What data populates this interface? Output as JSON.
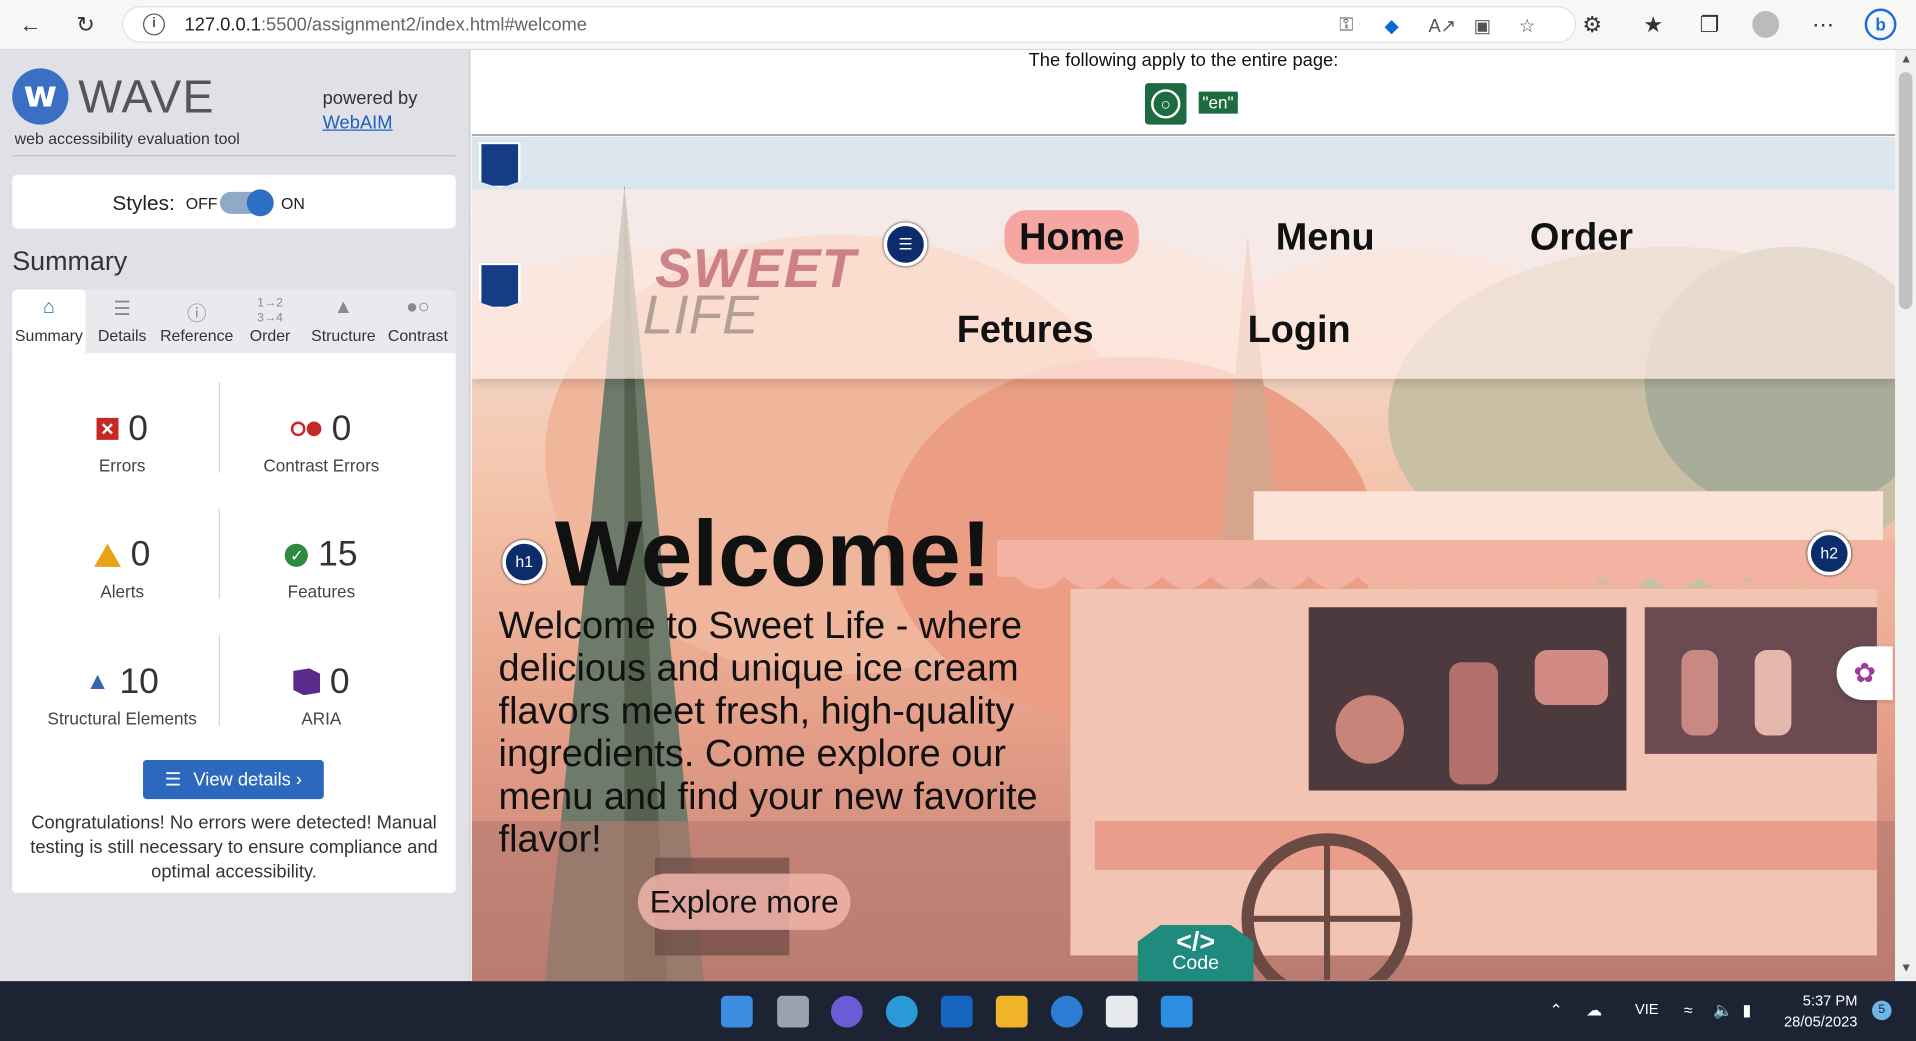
{
  "browser": {
    "url_host": "127.0.0.1",
    "url_path": ":5500/assignment2/index.html#welcome"
  },
  "wave": {
    "name": "WAVE",
    "subtitle": "web accessibility evaluation tool",
    "powered_by": "powered by",
    "webaim": "WebAIM",
    "styles_label": "Styles:",
    "styles_off": "OFF",
    "styles_on": "ON",
    "summary_title": "Summary",
    "tabs": [
      "Summary",
      "Details",
      "Reference",
      "Order",
      "Structure",
      "Contrast"
    ],
    "metrics": {
      "errors": {
        "value": "0",
        "label": "Errors"
      },
      "contrast": {
        "value": "0",
        "label": "Contrast Errors"
      },
      "alerts": {
        "value": "0",
        "label": "Alerts"
      },
      "features": {
        "value": "15",
        "label": "Features"
      },
      "structural": {
        "value": "10",
        "label": "Structural Elements"
      },
      "aria": {
        "value": "0",
        "label": "ARIA"
      }
    },
    "view_details": "View details ›",
    "congrats": "Congratulations! No errors were detected! Manual testing is still necessary to ensure compliance and optimal accessibility."
  },
  "page": {
    "apply_text": "The following apply to the entire page:",
    "lang_tag": "\"en\"",
    "brand_line1": "SWEET",
    "brand_line2": "LIFE",
    "nav": [
      "Home",
      "Menu",
      "Order",
      "Fetures",
      "Login"
    ],
    "h1_badge": "h1",
    "h2_badge": "h2",
    "welcome": "Welcome!",
    "intro": "Welcome to Sweet Life - where delicious and unique ice cream flavors meet fresh, high-quality ingredients. Come explore our menu and find your new favorite flavor!",
    "explore": "Explore more",
    "code_label": "Code",
    "code_symbol": "</>"
  },
  "taskbar": {
    "lang": "VIE",
    "time": "5:37 PM",
    "date": "28/05/2023",
    "notif_count": "5"
  }
}
